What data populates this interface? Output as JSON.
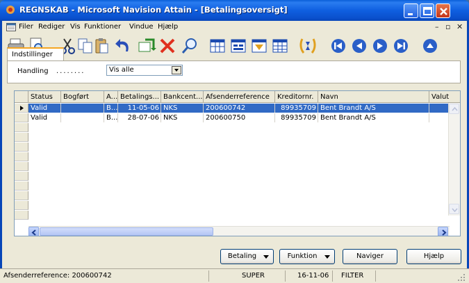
{
  "window": {
    "title": "REGNSKAB - Microsoft Navision Attain - [Betalingsoversigt]"
  },
  "menu": [
    "Filer",
    "Rediger",
    "Vis",
    "Funktioner",
    "Vindue",
    "Hjælp"
  ],
  "toolbar_icons": [
    "print-icon",
    "print-preview-icon",
    "cut-icon",
    "copy-icon",
    "paste-icon",
    "undo-icon",
    "refresh-icon",
    "delete-icon",
    "find-icon",
    "table-icon",
    "form-icon",
    "sort-icon",
    "filter-icon",
    "flowfilter-icon",
    "first-icon",
    "previous-icon",
    "next-icon",
    "last-icon",
    "up-icon"
  ],
  "options": {
    "tab_label": "Indstillinger",
    "field_label": "Handling",
    "dots": "........",
    "field_value": "Vis alle"
  },
  "grid": {
    "columns": [
      "Status",
      "Bogført",
      "A...",
      "Betalings...",
      "Bankcent...",
      "Afsenderreference",
      "Kreditornr.",
      "Navn",
      "Valut"
    ],
    "rows": [
      {
        "status": "Valid",
        "bogfoert": "",
        "a": "B...",
        "dato": "11-05-06",
        "bank": "NKS",
        "ref": "200600742",
        "kreditor": "89935709",
        "navn": "Bent Brandt A/S",
        "valuta": ""
      },
      {
        "status": "Valid",
        "bogfoert": "",
        "a": "B...",
        "dato": "28-07-06",
        "bank": "NKS",
        "ref": "200600750",
        "kreditor": "89935709",
        "navn": "Bent Brandt A/S",
        "valuta": ""
      }
    ],
    "selected_row": 0
  },
  "buttons": {
    "betaling": "Betaling",
    "funktion": "Funktion",
    "naviger": "Naviger",
    "hjaelp": "Hjælp"
  },
  "statusbar": {
    "field": "Afsenderreference: 200600742",
    "user": "SUPER",
    "date": "16-11-06",
    "filter": "FILTER"
  }
}
